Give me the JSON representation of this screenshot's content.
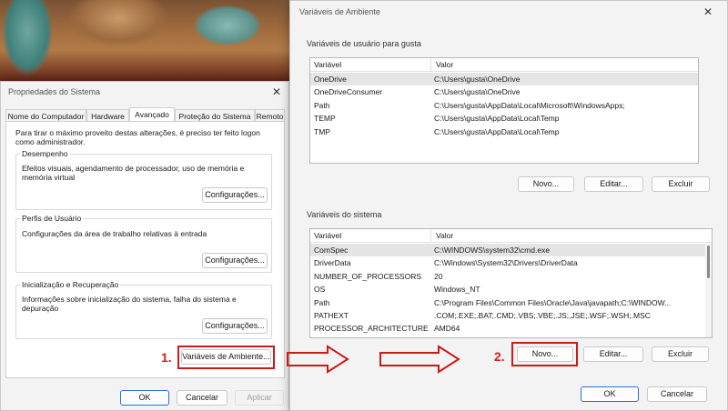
{
  "system_props": {
    "title": "Propriedades do Sistema",
    "tabs": [
      "Nome do Computador",
      "Hardware",
      "Avançado",
      "Proteção do Sistema",
      "Remoto"
    ],
    "admin_note": "Para tirar o máximo proveito destas alterações, é preciso ter feito logon como administrador.",
    "groups": [
      {
        "title": "Desempenho",
        "text": "Efeitos visuais, agendamento de processador, uso de memória e memória virtual",
        "button": "Configurações..."
      },
      {
        "title": "Perfis de Usuário",
        "text": "Configurações da área de trabalho relativas à entrada",
        "button": "Configurações..."
      },
      {
        "title": "Inicialização e Recuperação",
        "text": "Informações sobre inicialização do sistema, falha do sistema e depuração",
        "button": "Configurações..."
      }
    ],
    "env_button": "Variáveis de Ambiente...",
    "ok": "OK",
    "cancel": "Cancelar",
    "apply": "Aplicar"
  },
  "env_vars": {
    "title": "Variáveis de Ambiente",
    "user_section": "Variáveis de usuário para gusta",
    "system_section": "Variáveis do sistema",
    "col_var": "Variável",
    "col_val": "Valor",
    "user_vars": [
      {
        "name": "OneDrive",
        "value": "C:\\Users\\gusta\\OneDrive"
      },
      {
        "name": "OneDriveConsumer",
        "value": "C:\\Users\\gusta\\OneDrive"
      },
      {
        "name": "Path",
        "value": "C:\\Users\\gusta\\AppData\\Local\\Microsoft\\WindowsApps;"
      },
      {
        "name": "TEMP",
        "value": "C:\\Users\\gusta\\AppData\\Local\\Temp"
      },
      {
        "name": "TMP",
        "value": "C:\\Users\\gusta\\AppData\\Local\\Temp"
      }
    ],
    "system_vars": [
      {
        "name": "ComSpec",
        "value": "C:\\WINDOWS\\system32\\cmd.exe"
      },
      {
        "name": "DriverData",
        "value": "C:\\Windows\\System32\\Drivers\\DriverData"
      },
      {
        "name": "NUMBER_OF_PROCESSORS",
        "value": "20"
      },
      {
        "name": "OS",
        "value": "Windows_NT"
      },
      {
        "name": "Path",
        "value": "C:\\Program Files\\Common Files\\Oracle\\Java\\javapath;C:\\WINDOW..."
      },
      {
        "name": "PATHEXT",
        "value": ".COM;.EXE;.BAT;.CMD;.VBS;.VBE;.JS;.JSE;.WSF;.WSH;.MSC"
      },
      {
        "name": "PROCESSOR_ARCHITECTURE",
        "value": "AMD64"
      }
    ],
    "new": "Novo...",
    "edit": "Editar...",
    "delete": "Excluir",
    "ok": "OK",
    "cancel": "Cancelar"
  },
  "annotations": {
    "step1": "1.",
    "step2": "2."
  },
  "colors": {
    "annotation": "#d42020",
    "arrow": "#cc1a1a"
  }
}
